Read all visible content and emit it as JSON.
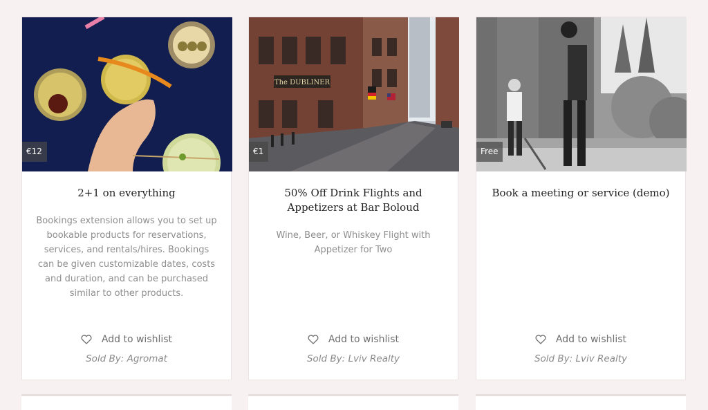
{
  "products": [
    {
      "price": "€12",
      "title": "2+1 on everything",
      "description": "Bookings extension allows you to set up bookable products for reservations, services, and rentals/hires. Bookings can be given customizable dates, costs and duration, and can be purchased similar to other products.",
      "wishlist_label": "Add to wishlist",
      "sold_by": "Sold By: Agromat"
    },
    {
      "price": "€1",
      "title": "50% Off Drink Flights and Appetizers at Bar Boloud",
      "description": "Wine, Beer, or Whiskey Flight with Appetizer for Two",
      "sign_text": "The DUBLINER",
      "wishlist_label": "Add to wishlist",
      "sold_by": "Sold By: Lviv Realty"
    },
    {
      "price": "Free",
      "title": "Book a meeting or service (demo)",
      "description": "",
      "wishlist_label": "Add to wishlist",
      "sold_by": "Sold By: Lviv Realty"
    }
  ],
  "colors": {
    "page_bg": "#f8f1f1",
    "card_bg": "#ffffff",
    "title": "#222222",
    "muted": "#8e8e8e"
  }
}
